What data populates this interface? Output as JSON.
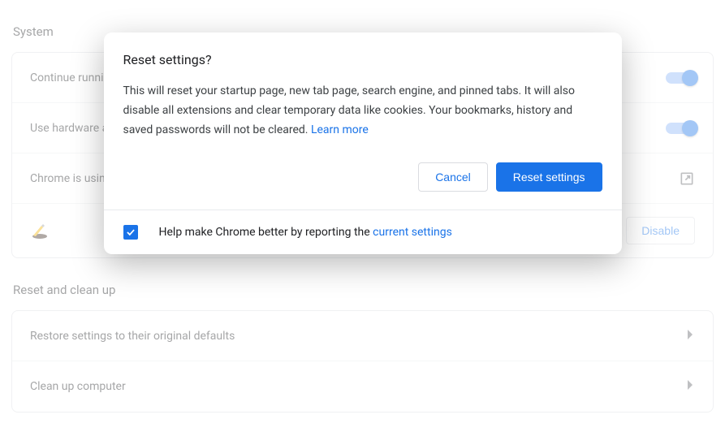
{
  "sections": {
    "system": {
      "title": "System",
      "rows": {
        "continue": {
          "label": "Continue running background apps when Google Chrome is closed",
          "on": true
        },
        "hardware": {
          "label": "Use hardware acceleration when available",
          "on": true
        },
        "proxy": {
          "label": "Chrome is using your computer's proxy settings"
        }
      },
      "extension": {
        "disable_label": "Disable"
      }
    },
    "reset": {
      "title": "Reset and clean up",
      "rows": {
        "restore": {
          "label": "Restore settings to their original defaults"
        },
        "cleanup": {
          "label": "Clean up computer"
        }
      }
    }
  },
  "dialog": {
    "title": "Reset settings?",
    "body": "This will reset your startup page, new tab page, search engine, and pinned tabs. It will also disable all extensions and clear temporary data like cookies. Your bookmarks, history and saved passwords will not be cleared. ",
    "learn_more": "Learn more",
    "cancel": "Cancel",
    "confirm": "Reset settings",
    "footer_prefix": "Help make Chrome better by reporting the ",
    "footer_link": "current settings",
    "checkbox_checked": true
  }
}
